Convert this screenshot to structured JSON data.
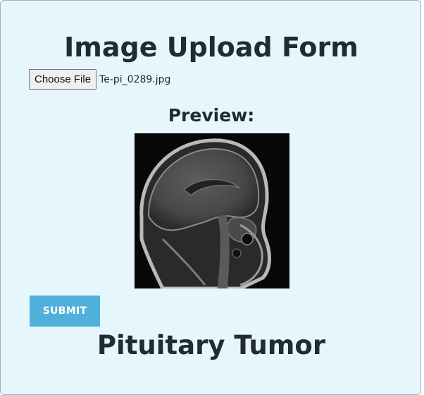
{
  "form": {
    "title": "Image Upload Form",
    "choose_file_label": "Choose File",
    "file_name": "Te-pi_0289.jpg",
    "preview_label": "Preview:",
    "submit_label": "SUBMIT"
  },
  "result": {
    "text": "Pituitary Tumor"
  },
  "colors": {
    "panel_background": "#e5f6fc",
    "submit_button": "#4fb0db",
    "text": "#222a33"
  },
  "preview": {
    "image_content": "MRI brain scan (sagittal)"
  }
}
